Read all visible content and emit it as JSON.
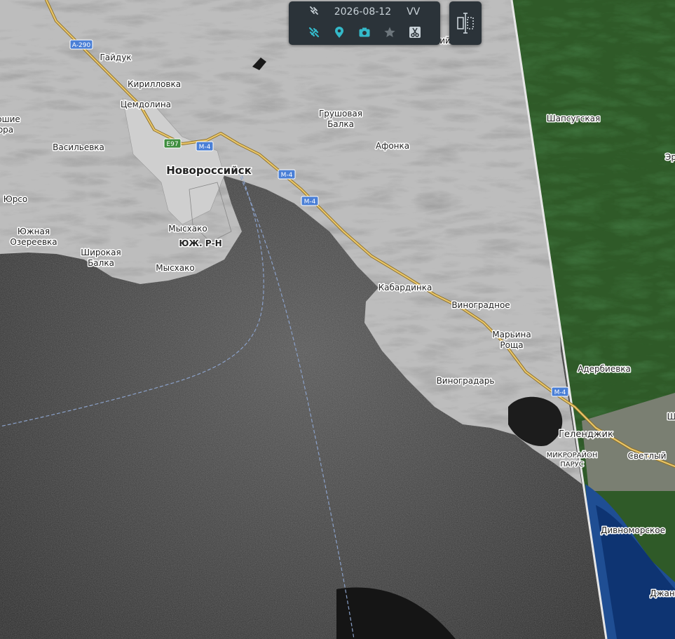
{
  "toolbar": {
    "date": "2026-08-12",
    "polarization": "VV",
    "icons": [
      "satellite-icon",
      "satellite-icon",
      "location-pin-icon",
      "camera-icon",
      "star-icon",
      "scissors-icon"
    ]
  },
  "colors": {
    "accent": "#34b9c9",
    "panel": "#2b3339",
    "road": "#d8b55a",
    "shield": "#4a7fd6"
  },
  "map": {
    "place_labels": [
      "Гайдук",
      "Кирилловка",
      "Цемдолина",
      "Васильевка",
      "Новороссийск",
      "Грушовая",
      "Балка",
      "Афонка",
      "ошие",
      "ора",
      "Юрсо",
      "Южная",
      "Озереевка",
      "Мысхако",
      "ЮЖ. Р-Н",
      "Широкая",
      "Балка",
      "Мысхако",
      "Кабардинка",
      "Виноградное",
      "Марьина",
      "Роща",
      "Виноградарь",
      "Геленджик",
      "МИКРОРАЙОН",
      "ПАРУС",
      "Светлый",
      "Шапсугская",
      "Адербиевка",
      "Дивноморское",
      "Джан",
      "Эр",
      "Ш",
      "ий"
    ],
    "road_shields": [
      "A-290",
      "E97",
      "M-4",
      "M-4",
      "M-4",
      "M-4"
    ]
  }
}
